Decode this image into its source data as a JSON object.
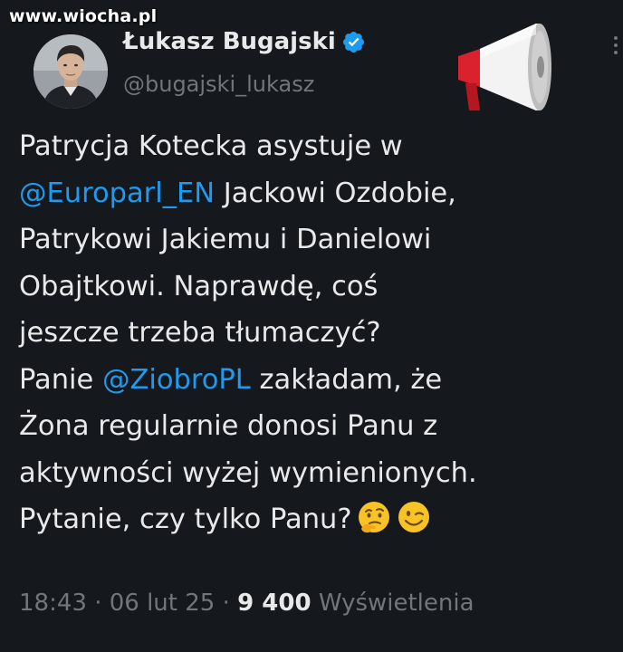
{
  "watermark": "www.wiocha.pl",
  "author": {
    "display_name": "Łukasz Bugajski",
    "handle": "@bugajski_lukasz",
    "verified": true
  },
  "tweet": {
    "lines": [
      [
        {
          "text": "Patrycja Kotecka asystuje w",
          "type": "text"
        }
      ],
      [
        {
          "text": "@Europarl_EN",
          "type": "mention"
        },
        {
          "text": " Jackowi Ozdobie,",
          "type": "text"
        }
      ],
      [
        {
          "text": "Patrykowi Jakiemu i Danielowi",
          "type": "text"
        }
      ],
      [
        {
          "text": "Obajtkowi. Naprawdę, coś",
          "type": "text"
        }
      ],
      [
        {
          "text": "jeszcze trzeba tłumaczyć?",
          "type": "text"
        }
      ],
      [
        {
          "text": "Panie ",
          "type": "text"
        },
        {
          "text": "@ZiobroPL",
          "type": "mention"
        },
        {
          "text": " zakładam, że",
          "type": "text"
        }
      ],
      [
        {
          "text": "Żona regularnie donosi Panu z",
          "type": "text"
        }
      ],
      [
        {
          "text": "aktywności wyżej wymienionych.",
          "type": "text"
        }
      ],
      [
        {
          "text": "Pytanie, czy tylko Panu?",
          "type": "text"
        }
      ]
    ],
    "trailing_emojis": [
      "thinking-face-emoji",
      "winking-face-emoji"
    ]
  },
  "meta": {
    "time": "18:43",
    "separator": " · ",
    "date": "06 lut 25",
    "views_count": "9 400",
    "views_label": "Wyświetlenia"
  },
  "colors": {
    "background": "#15181c",
    "text": "#e7e9ea",
    "secondary": "#71767b",
    "mention": "#1d9bf0",
    "verified": "#1d9bf0"
  },
  "icons": {
    "avatar": "avatar",
    "badge": "verified-badge-icon",
    "megaphone": "megaphone-icon",
    "more": "more-options-icon"
  }
}
